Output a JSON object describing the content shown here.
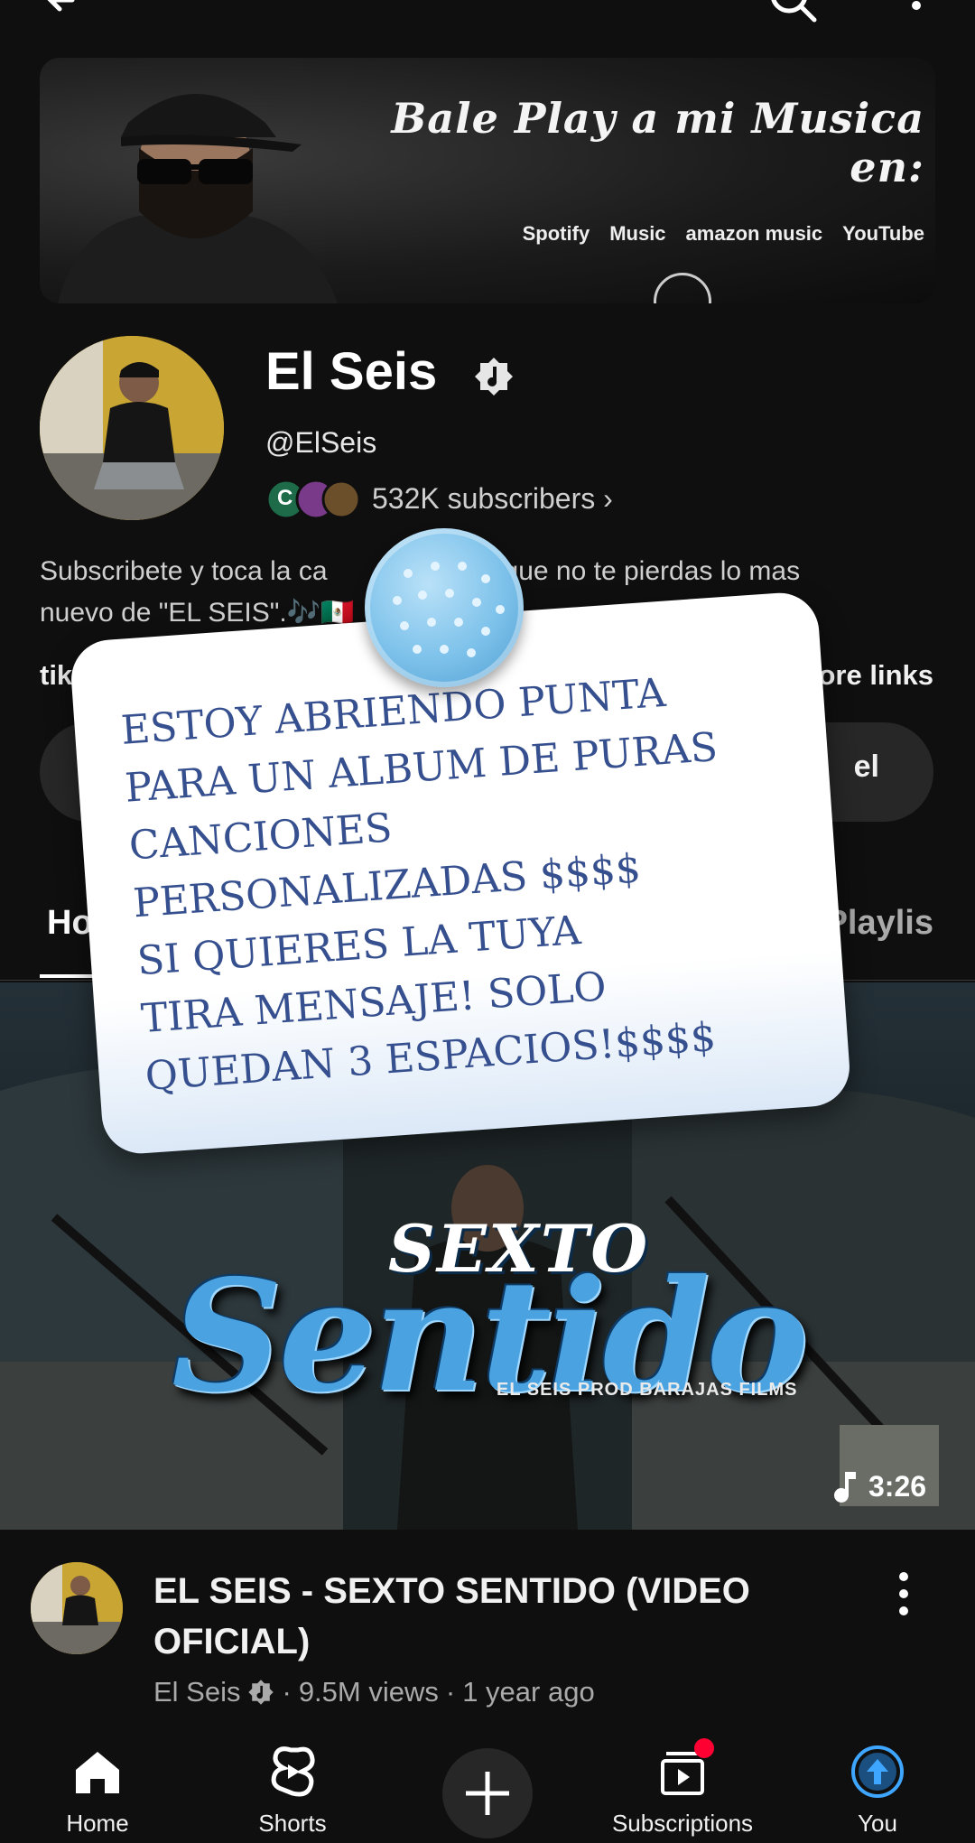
{
  "banner": {
    "headline": "Bale Play a mi Musica en:",
    "services": [
      "Spotify",
      "Music",
      "amazon music",
      "YouTube"
    ]
  },
  "channel": {
    "name": "El Seis",
    "handle": "@ElSeis",
    "subscriber_avatar_letter": "C",
    "subscribers": "532K subscribers",
    "description": "Subscribete y toca la cam…a que no te pierdas lo mas nuevo de \"EL SEIS\".🎶🇲🇽",
    "desc_line1_start": "Subscribete y toca la ca",
    "desc_line1_end": "a que no te pierdas lo mas",
    "desc_line2": "nuevo de \"EL SEIS\".",
    "links_left": "tikt",
    "links_right": "ore links",
    "subscribe_tail": "el"
  },
  "tabs": {
    "home": "Ho",
    "playlists": "Playlis"
  },
  "video": {
    "logo_top": "SEXTO",
    "logo_main": "Sentido",
    "credit": "EL SEIS  PROD BARAJAS FILMS",
    "duration": "3:26",
    "title": "EL SEIS - SEXTO SENTIDO (VIDEO OFICIAL)",
    "channel": "El Seis",
    "views": "9.5M views",
    "age": "1 year ago"
  },
  "note": {
    "text": "ESTOY ABRIENDO PUNTA\nPARA UN ALBUM DE PURAS\n CANCIONES\nPERSONALIZADAS $$$$\n SI QUIERES LA TUYA\n TIRA MENSAJE! SOLO\nQUEDAN 3 ESPACIOS!$$$$"
  },
  "nav": {
    "home": "Home",
    "shorts": "Shorts",
    "subscriptions": "Subscriptions",
    "you": "You"
  },
  "colors": {
    "background": "#0f0f0f",
    "note_text": "#36508f",
    "pin": "#7cc1ea",
    "notification": "#ff0033",
    "you_accent": "#3ea6ff"
  }
}
